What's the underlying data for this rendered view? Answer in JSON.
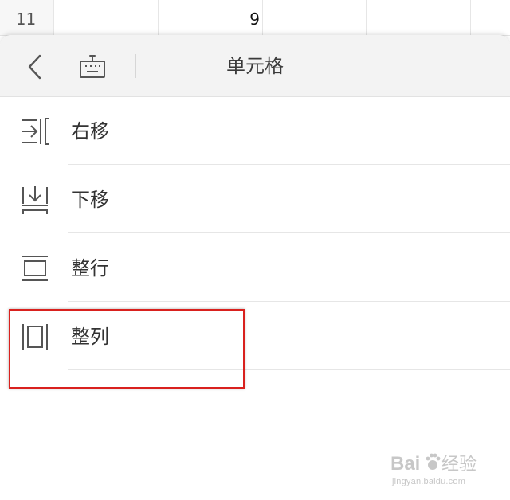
{
  "sheet": {
    "row_number": "11",
    "cell_value": "9"
  },
  "panel": {
    "title": "单元格",
    "back_icon": "chevron-left-icon",
    "keyboard_icon": "keyboard-icon",
    "items": [
      {
        "label": "右移",
        "icon": "shift-right-icon"
      },
      {
        "label": "下移",
        "icon": "shift-down-icon"
      },
      {
        "label": "整行",
        "icon": "entire-row-icon"
      },
      {
        "label": "整列",
        "icon": "entire-column-icon"
      }
    ]
  },
  "highlight": {
    "color": "#d9211e"
  },
  "watermark": {
    "logo_text": "Bai du 经验",
    "url": "jingyan.baidu.com"
  },
  "colors": {
    "header_bg": "#f3f3f3",
    "icon_stroke": "#555555",
    "text": "#333333"
  }
}
